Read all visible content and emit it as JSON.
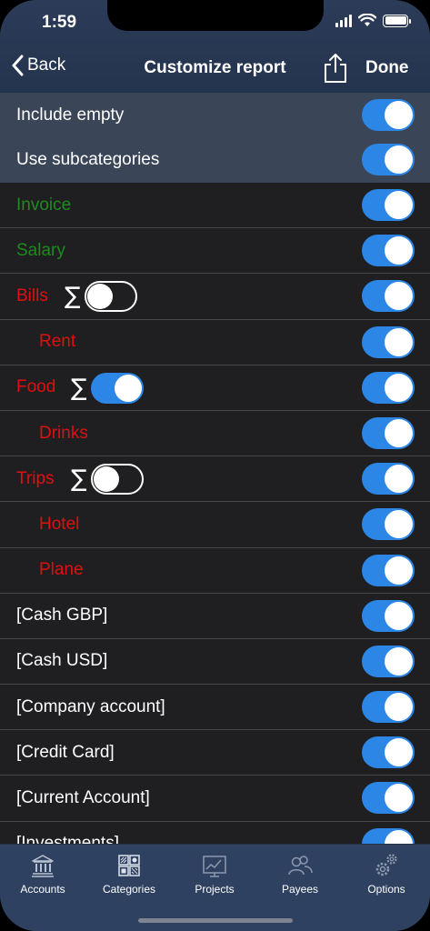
{
  "status": {
    "time": "1:59"
  },
  "nav": {
    "back_label": "Back",
    "title": "Customize report",
    "done_label": "Done",
    "share_icon": "share-icon"
  },
  "options": [
    {
      "label": "Include empty",
      "on": true
    },
    {
      "label": "Use subcategories",
      "on": true
    }
  ],
  "rows": [
    {
      "label": "Invoice",
      "color": "green",
      "indent": false,
      "on": true
    },
    {
      "label": "Salary",
      "color": "green",
      "indent": false,
      "on": true
    },
    {
      "label": "Bills",
      "color": "red",
      "indent": false,
      "on": true,
      "sum": false
    },
    {
      "label": "Rent",
      "color": "red",
      "indent": true,
      "on": true
    },
    {
      "label": "Food",
      "color": "red",
      "indent": false,
      "on": true,
      "sum": true
    },
    {
      "label": "Drinks",
      "color": "red",
      "indent": true,
      "on": true
    },
    {
      "label": "Trips",
      "color": "red",
      "indent": false,
      "on": true,
      "sum": false
    },
    {
      "label": "Hotel",
      "color": "red",
      "indent": true,
      "on": true
    },
    {
      "label": "Plane",
      "color": "red",
      "indent": true,
      "on": true
    },
    {
      "label": "[Cash GBP]",
      "color": "white",
      "indent": false,
      "on": true
    },
    {
      "label": "[Cash USD]",
      "color": "white",
      "indent": false,
      "on": true
    },
    {
      "label": "[Company account]",
      "color": "white",
      "indent": false,
      "on": true
    },
    {
      "label": "[Credit Card]",
      "color": "white",
      "indent": false,
      "on": true
    },
    {
      "label": "[Current Account]",
      "color": "white",
      "indent": false,
      "on": true
    },
    {
      "label": "[Investments]",
      "color": "white",
      "indent": false,
      "on": true
    }
  ],
  "sum_symbol": "∑",
  "tabs": [
    {
      "label": "Accounts",
      "icon": "bank-icon"
    },
    {
      "label": "Categories",
      "icon": "categories-grid-icon"
    },
    {
      "label": "Projects",
      "icon": "chart-board-icon"
    },
    {
      "label": "Payees",
      "icon": "people-icon"
    },
    {
      "label": "Options",
      "icon": "gears-icon"
    }
  ],
  "colors": {
    "accent": "#2c86e6",
    "income": "#1c8d1c",
    "expense": "#e00f0f",
    "header": "#2c3c58",
    "options_bg": "#3a4658",
    "list_bg": "#1f1f22"
  }
}
